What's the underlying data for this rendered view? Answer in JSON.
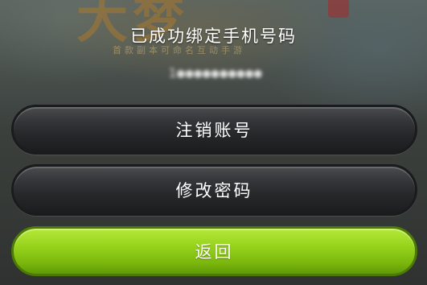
{
  "background": {
    "logo_text": "大梦",
    "slogan": "首款副本可命名互动手游"
  },
  "dialog": {
    "title": "已成功绑定手机号码",
    "phone_masked": "1●●●●●●●●●●"
  },
  "buttons": {
    "logout": "注销账号",
    "change_password": "修改密码",
    "back": "返回"
  },
  "colors": {
    "accent_green": "#8fcb17",
    "dark_button": "#2a2c2e"
  }
}
